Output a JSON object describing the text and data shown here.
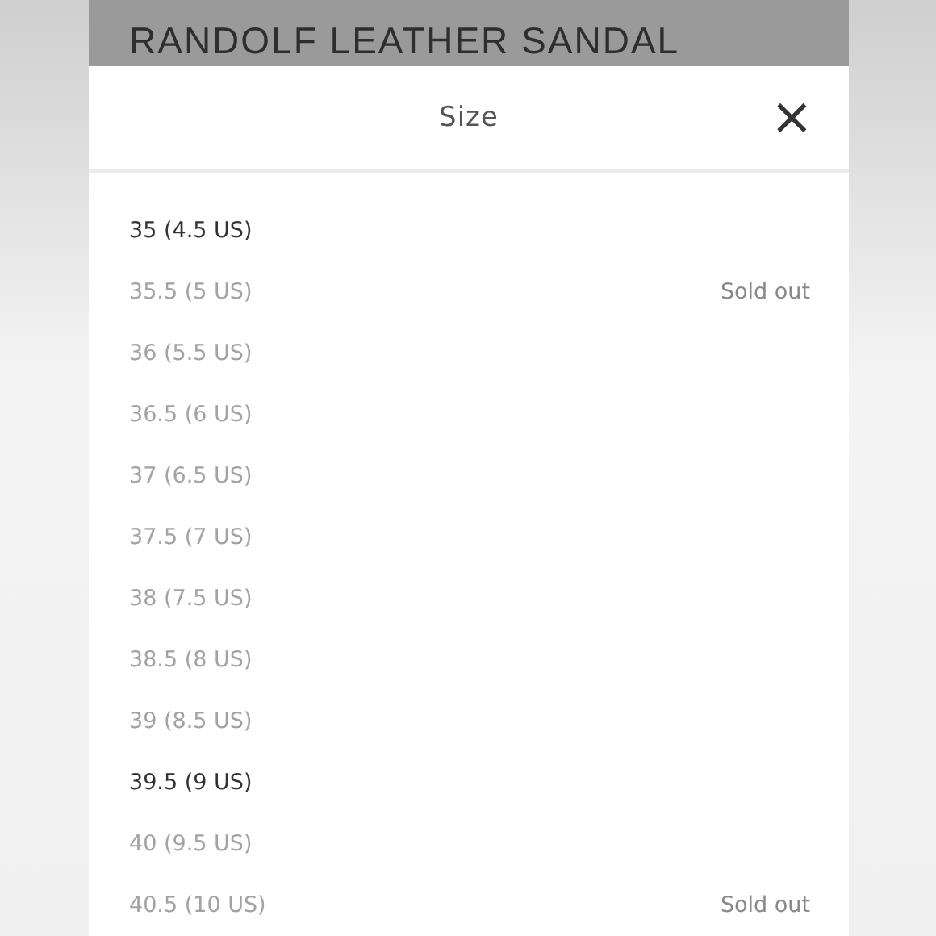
{
  "product_title": "RANDOLF LEATHER SANDAL",
  "size_panel": {
    "title": "Size",
    "close": "×"
  },
  "sizes": [
    {
      "label": "35 (4.5 US)",
      "available": true
    },
    {
      "label": "35.5 (5 US)",
      "available": false,
      "note": "Sold out"
    },
    {
      "label": "36 (5.5 US)",
      "available": false
    },
    {
      "label": "36.5 (6 US)",
      "available": false
    },
    {
      "label": "37 (6.5 US)",
      "available": false
    },
    {
      "label": "37.5 (7 US)",
      "available": false
    },
    {
      "label": "38 (7.5 US)",
      "available": false
    },
    {
      "label": "38.5 (8 US)",
      "available": false
    },
    {
      "label": "39 (8.5 US)",
      "available": false
    },
    {
      "label": "39.5 (9 US)",
      "available": true
    },
    {
      "label": "40 (9.5 US)",
      "available": false
    },
    {
      "label": "40.5 (10 US)",
      "available": false,
      "note": "Sold out"
    }
  ]
}
